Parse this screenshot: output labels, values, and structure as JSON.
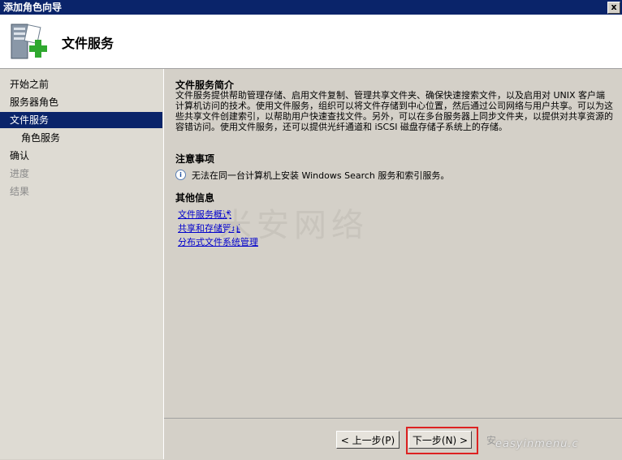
{
  "window": {
    "title": "添加角色向导",
    "close_glyph": "x"
  },
  "header": {
    "title": "文件服务"
  },
  "sidebar": {
    "items": [
      {
        "label": "开始之前",
        "state": "normal"
      },
      {
        "label": "服务器角色",
        "state": "normal"
      },
      {
        "label": "文件服务",
        "state": "selected"
      },
      {
        "label": "角色服务",
        "state": "normal",
        "indent": true
      },
      {
        "label": "确认",
        "state": "normal"
      },
      {
        "label": "进度",
        "state": "disabled"
      },
      {
        "label": "结果",
        "state": "disabled"
      }
    ]
  },
  "content": {
    "intro_title": "文件服务简介",
    "intro_text": "文件服务提供帮助管理存储、启用文件复制、管理共享文件夹、确保快速搜索文件，以及启用对 UNIX 客户端计算机访问的技术。使用文件服务，组织可以将文件存储到中心位置，然后通过公司网络与用户共享。可以为这些共享文件创建索引，以帮助用户快速查找文件。另外，可以在多台服务器上同步文件夹，以提供对共享资源的容错访问。使用文件服务，还可以提供光纤通道和 iSCSI 磁盘存储子系统上的存储。",
    "notes_title": "注意事项",
    "note_text": "无法在同一台计算机上安装 Windows Search 服务和索引服务。",
    "more_title": "其他信息",
    "links": [
      "文件服务概述",
      "共享和存储管理",
      "分布式文件系统管理"
    ],
    "watermark": "米安网络"
  },
  "footer": {
    "prev_label": "< 上一步(P)",
    "next_label": "下一步(N) >",
    "install_label": "安",
    "watermark": "easyinmenu.c"
  },
  "colors": {
    "titlebar": "#0a246a",
    "selected": "#0a246a",
    "link": "#0000cc",
    "highlight": "#d22222"
  }
}
